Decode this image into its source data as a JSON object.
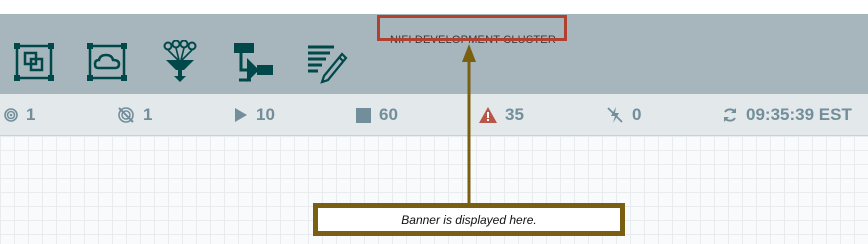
{
  "banner": {
    "text": "NIFI DEVELOPMENT CLUSTER"
  },
  "toolbar": {
    "buttons": [
      {
        "icon": "group-icon"
      },
      {
        "icon": "remote-process-group-icon"
      },
      {
        "icon": "funnel-icon"
      },
      {
        "icon": "template-icon"
      },
      {
        "icon": "label-icon"
      }
    ],
    "icon_color": "#004849"
  },
  "status": {
    "transmitting": "1",
    "not_transmitting": "1",
    "running": "10",
    "stopped": "60",
    "invalid": "35",
    "disabled": "0",
    "refresh_time": "09:35:39 EST"
  },
  "colors": {
    "toolbar_bg": "#a7b6bc",
    "status_text": "#728e9b",
    "invalid_color": "#ba554a",
    "banner_highlight": "#b0402f",
    "annotation_color": "#7a5f10"
  },
  "annotation": {
    "text": "Banner is displayed here."
  }
}
